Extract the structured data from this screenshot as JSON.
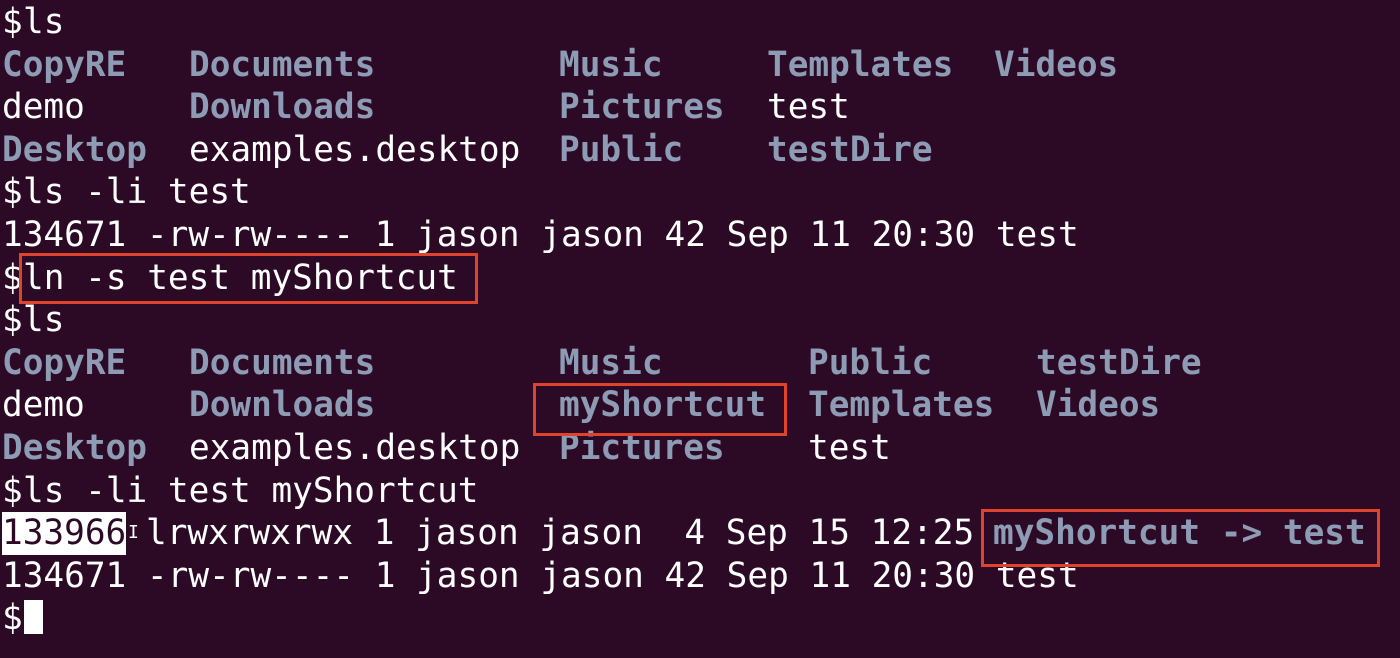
{
  "terminal": {
    "colors": {
      "background": "#2c0a26",
      "text": "#ffffff",
      "directory": "#8d9bb4",
      "highlight_box": "#e0432b"
    },
    "prompt": "$",
    "block1": {
      "command": "ls",
      "rows": [
        [
          "CopyRE",
          "Documents",
          "Music",
          "Templates",
          "Videos"
        ],
        [
          "demo",
          "Downloads",
          "Pictures",
          "test"
        ],
        [
          "Desktop",
          "examples.desktop",
          "Public",
          "testDire"
        ]
      ]
    },
    "block2": {
      "command": "ls -li test",
      "output": "134671 -rw-rw---- 1 jason jason 42 Sep 11 20:30 test"
    },
    "block3": {
      "command": "ln -s test myShortcut"
    },
    "block4": {
      "command": "ls",
      "rows": [
        [
          "CopyRE",
          "Documents",
          "Music",
          "Public",
          "testDire"
        ],
        [
          "demo",
          "Downloads",
          "myShortcut",
          "Templates",
          "Videos"
        ],
        [
          "Desktop",
          "examples.desktop",
          "Pictures",
          "test"
        ]
      ]
    },
    "block5": {
      "command": "ls -li test myShortcut",
      "link_inode": "133966",
      "link_meta": "lrwxrwxrwx 1 jason jason  4 Sep 15 12:25",
      "link_target": "myShortcut -> test",
      "file_line": "134671 -rw-rw---- 1 jason jason 42 Sep 11 20:30 test"
    },
    "ibeam_glyph": "I"
  }
}
